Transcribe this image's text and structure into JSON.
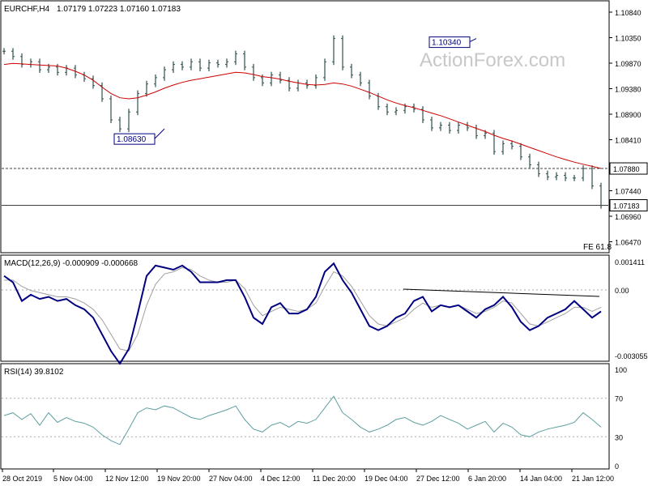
{
  "header": {
    "symbol": "EURCHF,H4",
    "ohlc": "1.07179 1.07223 1.07160 1.07183"
  },
  "watermark": "ActionForex.com",
  "price_panel": {
    "yticks": [
      "1.10840",
      "1.10350",
      "1.09870",
      "1.09380",
      "1.08900",
      "1.08410",
      "1.07920",
      "1.07440",
      "1.06960",
      "1.06470"
    ],
    "fe_label": "FE 61.8",
    "annotations": [
      {
        "text": "1.10340",
        "x": 53,
        "y": 1.1034
      },
      {
        "text": "1.08630",
        "x": 18,
        "y": 1.0863
      }
    ],
    "hlines": [
      {
        "y": 1.0788,
        "label": "1.07880",
        "style": "dashed"
      },
      {
        "y": 1.07183,
        "label": "1.07183",
        "style": "solid"
      }
    ]
  },
  "macd_panel": {
    "title": "MACD(12,26,9) -0.000909 -0.000668",
    "yticks": [
      "0.001411",
      "0.00",
      "-0.003055"
    ]
  },
  "rsi_panel": {
    "title": "RSI(14) 39.8102",
    "yticks": [
      "100",
      "70",
      "30",
      "0"
    ]
  },
  "xaxis": {
    "labels": [
      "28 Oct 2019",
      "5 Nov 04:00",
      "12 Nov 12:00",
      "19 Nov 20:00",
      "27 Nov 04:00",
      "4 Dec 12:00",
      "11 Dec 20:00",
      "19 Dec 04:00",
      "27 Dec 12:00",
      "6 Jan 20:00",
      "14 Jan 04:00",
      "21 Jan 12:00"
    ]
  },
  "colors": {
    "candles": "#2f4f4f",
    "ma": "#cc0000",
    "macd_line": "#000080",
    "macd_signal": "#a0a0a0",
    "rsi": "#5f9ea0",
    "dashed": "#404040",
    "annotation_text": "#000080"
  },
  "chart_data": [
    {
      "type": "line",
      "title": "EURCHF,H4",
      "description_key": "price",
      "x_unit": "4-hour bars",
      "ylim": [
        1.0647,
        1.1084
      ],
      "series": [
        {
          "name": "close",
          "values": [
            1.101,
            1.1,
            1.0985,
            1.099,
            1.0975,
            1.098,
            1.097,
            1.0978,
            1.0965,
            1.0958,
            1.0945,
            1.092,
            1.088,
            1.0863,
            1.0895,
            1.093,
            1.0948,
            1.096,
            1.0975,
            1.0985,
            1.098,
            1.099,
            1.0978,
            1.0988,
            1.0985,
            1.099,
            1.1005,
            1.098,
            1.096,
            1.095,
            1.0965,
            1.0955,
            1.094,
            1.095,
            1.0945,
            1.096,
            1.099,
            1.1034,
            1.098,
            1.0965,
            1.095,
            1.0925,
            1.0905,
            1.0895,
            1.0898,
            1.0905,
            1.09,
            1.088,
            1.0865,
            1.087,
            1.086,
            1.087,
            1.0865,
            1.085,
            1.0855,
            1.082,
            1.0835,
            1.083,
            1.081,
            1.0795,
            1.0778,
            1.0772,
            1.0775,
            1.077,
            1.077,
            1.0788,
            1.0755,
            1.0718
          ]
        },
        {
          "name": "MA",
          "values": [
            1.0985,
            1.0987,
            1.0986,
            1.0985,
            1.0984,
            1.0983,
            1.0982,
            1.0978,
            1.0972,
            1.0965,
            1.0955,
            1.0942,
            1.093,
            1.0922,
            1.092,
            1.0922,
            1.0927,
            1.0933,
            1.094,
            1.0946,
            1.0951,
            1.0955,
            1.0958,
            1.0961,
            1.0964,
            1.0967,
            1.097,
            1.0969,
            1.0966,
            1.0962,
            1.096,
            1.0957,
            1.0953,
            1.095,
            1.0947,
            1.0946,
            1.0947,
            1.095,
            1.0948,
            1.0944,
            1.0938,
            1.0932,
            1.0925,
            1.0918,
            1.0912,
            1.0907,
            1.0903,
            1.0898,
            1.0893,
            1.0888,
            1.0882,
            1.0876,
            1.087,
            1.0864,
            1.0858,
            1.0851,
            1.0845,
            1.084,
            1.0834,
            1.0828,
            1.0822,
            1.0816,
            1.081,
            1.0805,
            1.08,
            1.0796,
            1.0792,
            1.0788
          ]
        }
      ]
    },
    {
      "type": "line",
      "title": "MACD(12,26,9)",
      "ylim": [
        -0.003055,
        0.001411
      ],
      "series": [
        {
          "name": "MACD",
          "values": [
            0.0008,
            0.0005,
            -0.0004,
            -0.0001,
            -0.0003,
            -0.0002,
            -0.0004,
            -0.0003,
            -0.0006,
            -0.0008,
            -0.0012,
            -0.002,
            -0.0028,
            -0.0034,
            -0.0027,
            -0.001,
            0.0008,
            0.0013,
            0.0012,
            0.0011,
            0.0013,
            0.001,
            0.0005,
            0.0005,
            0.0005,
            0.0006,
            0.0006,
            -0.0002,
            -0.0012,
            -0.0015,
            -0.0007,
            -0.0005,
            -0.001,
            -0.001,
            -0.0008,
            -0.0002,
            0.001,
            0.0014,
            0.0006,
            0.0,
            -0.0008,
            -0.0016,
            -0.0018,
            -0.0016,
            -0.0012,
            -0.001,
            -0.0004,
            -0.0002,
            -0.0009,
            -0.0006,
            -0.0007,
            -0.0006,
            -0.0009,
            -0.0012,
            -0.0008,
            -0.0006,
            -0.0002,
            -0.0007,
            -0.0014,
            -0.0018,
            -0.0016,
            -0.0012,
            -0.001,
            -0.0008,
            -0.0004,
            -0.0008,
            -0.0012,
            -0.0009
          ]
        },
        {
          "name": "Signal",
          "values": [
            0.0006,
            0.0006,
            0.0003,
            0.0001,
            0.0,
            -0.0001,
            -0.0002,
            -0.0002,
            -0.0003,
            -0.0005,
            -0.0008,
            -0.0013,
            -0.002,
            -0.0027,
            -0.0028,
            -0.002,
            -0.0006,
            0.0004,
            0.0009,
            0.001,
            0.0012,
            0.0011,
            0.0008,
            0.0006,
            0.0005,
            0.0005,
            0.0006,
            0.0002,
            -0.0006,
            -0.0011,
            -0.0009,
            -0.0007,
            -0.0008,
            -0.0009,
            -0.0008,
            -0.0005,
            0.0003,
            0.001,
            0.0008,
            0.0003,
            -0.0004,
            -0.0011,
            -0.0015,
            -0.0016,
            -0.0014,
            -0.0012,
            -0.0008,
            -0.0005,
            -0.0007,
            -0.0006,
            -0.0007,
            -0.0006,
            -0.0008,
            -0.001,
            -0.0009,
            -0.0007,
            -0.0004,
            -0.0005,
            -0.001,
            -0.0015,
            -0.0016,
            -0.0014,
            -0.0012,
            -0.001,
            -0.0007,
            -0.0007,
            -0.0009,
            -0.0007
          ]
        }
      ]
    },
    {
      "type": "line",
      "title": "RSI(14)",
      "ylim": [
        0,
        100
      ],
      "series": [
        {
          "name": "RSI",
          "values": [
            52,
            55,
            48,
            54,
            42,
            55,
            45,
            50,
            46,
            44,
            40,
            32,
            26,
            22,
            38,
            55,
            60,
            58,
            62,
            60,
            55,
            50,
            48,
            52,
            55,
            58,
            62,
            48,
            38,
            35,
            42,
            45,
            40,
            46,
            44,
            48,
            60,
            72,
            55,
            48,
            40,
            35,
            38,
            42,
            48,
            50,
            45,
            42,
            46,
            52,
            48,
            44,
            38,
            42,
            46,
            35,
            44,
            40,
            32,
            30,
            35,
            38,
            40,
            42,
            45,
            55,
            48,
            40
          ]
        }
      ]
    }
  ]
}
